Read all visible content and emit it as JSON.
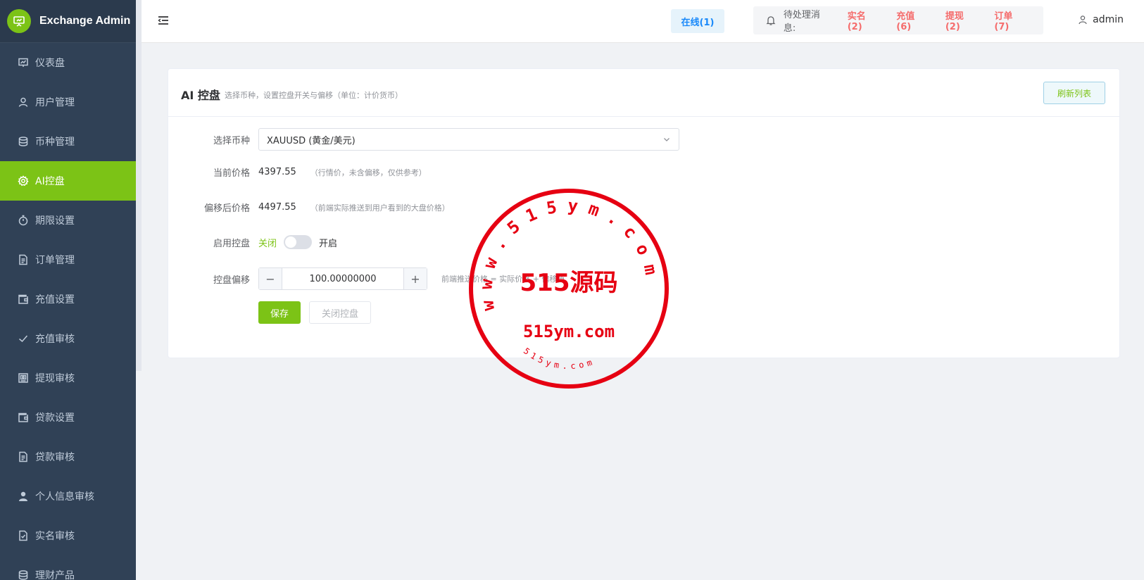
{
  "app": {
    "title": "Exchange Admin"
  },
  "sidebar": {
    "items": [
      {
        "label": "仪表盘",
        "icon": "chart-icon",
        "active": false
      },
      {
        "label": "用户管理",
        "icon": "user-icon",
        "active": false
      },
      {
        "label": "币种管理",
        "icon": "database-icon",
        "active": false
      },
      {
        "label": "AI控盘",
        "icon": "gear-icon",
        "active": true
      },
      {
        "label": "期限设置",
        "icon": "stopwatch-icon",
        "active": false
      },
      {
        "label": "订单管理",
        "icon": "document-icon",
        "active": false
      },
      {
        "label": "充值设置",
        "icon": "wallet-icon",
        "active": false
      },
      {
        "label": "充值审核",
        "icon": "check-icon",
        "active": false
      },
      {
        "label": "提现审核",
        "icon": "cash-icon",
        "active": false
      },
      {
        "label": "贷款设置",
        "icon": "wallet-icon",
        "active": false
      },
      {
        "label": "贷款审核",
        "icon": "document-icon",
        "active": false
      },
      {
        "label": "个人信息审核",
        "icon": "person-icon",
        "active": false
      },
      {
        "label": "实名审核",
        "icon": "document-check-icon",
        "active": false
      },
      {
        "label": "理财产品",
        "icon": "database-icon",
        "active": false
      }
    ]
  },
  "header": {
    "online": "在线(1)",
    "notice_label": "待处理消息:",
    "notices": [
      "实名(2)",
      "充值(6)",
      "提现(2)",
      "订单(7)"
    ],
    "user": "admin"
  },
  "card": {
    "title": "AI 控盘",
    "subtitle": "选择币种，设置控盘开关与偏移（单位：计价货币）",
    "refresh": "刷新列表"
  },
  "form": {
    "currency_label": "选择币种",
    "currency_value": "XAUUSD (黄金/美元)",
    "price_label": "当前价格",
    "price_value": "4397.55",
    "price_hint": "（行情价，未含偏移，仅供参考）",
    "offset_price_label": "偏移后价格",
    "offset_price_value": "4497.55",
    "offset_price_hint": "（前端实际推送到用户看到的大盘价格）",
    "enable_label": "启用控盘",
    "enable_off": "关闭",
    "enable_on": "开启",
    "enabled": false,
    "offset_label": "控盘偏移",
    "offset_value": "100.00000000",
    "offset_hint": "前端推送价格 = 实际价格 + 偏移值",
    "save": "保存",
    "close": "关闭控盘"
  },
  "watermark": {
    "ring_text": "www.515ym.com",
    "center_text": "515源码",
    "domain_text": "515ym.com",
    "bottom_text": "515ym.com",
    "color": "#e60012"
  },
  "colors": {
    "accent": "#7cc316",
    "sidebar": "#304156",
    "danger": "#f56c6c",
    "link": "#1989fa"
  }
}
